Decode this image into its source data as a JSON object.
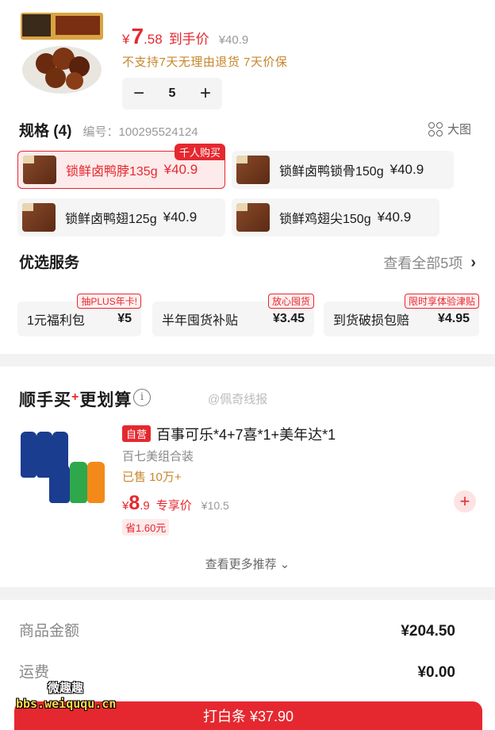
{
  "product": {
    "price_symbol": "¥",
    "price_int": "7",
    "price_dec": ".58",
    "price_label": "到手价",
    "orig_price": "¥40.9",
    "policy": "不支持7天无理由退货  7天价保",
    "stepper": {
      "minus": "−",
      "qty": "5",
      "plus": "+"
    }
  },
  "spec": {
    "title": "规格 (4)",
    "code": "编号：100295524124",
    "big_pic_label": "大图",
    "hot_tag": "千人购买",
    "items": [
      {
        "name": "锁鲜卤鸭脖135g",
        "price": "¥40.9"
      },
      {
        "name": "锁鲜卤鸭锁骨150g",
        "price": "¥40.9"
      },
      {
        "name": "锁鲜卤鸭翅125g",
        "price": "¥40.9"
      },
      {
        "name": "锁鲜鸡翅尖150g",
        "price": "¥40.9"
      }
    ]
  },
  "services": {
    "title": "优选服务",
    "view_all": "查看全部5项",
    "items": [
      {
        "name": "1元福利包",
        "value": "¥5",
        "tag": "抽PLUS年卡!"
      },
      {
        "name": "半年囤货补贴",
        "value": "¥3.45",
        "tag": "放心囤货"
      },
      {
        "name": "到货破损包赔",
        "value": "¥4.95",
        "tag": "限时享体验津贴"
      }
    ]
  },
  "bundle": {
    "title_a": "顺手买",
    "title_plus": "+",
    "title_b": "更划算",
    "info_icon": "i",
    "watermark": "@佩奇线报",
    "self_badge": "自营",
    "name": "百事可乐*4+7喜*1+美年达*1",
    "subtitle": "百七美组合装",
    "sold": "已售 10万+",
    "price_symbol": "¥",
    "price_int": "8",
    "price_dec": ".9",
    "price_label": "专享价",
    "orig_price": "¥10.5",
    "save": "省1.60元",
    "add": "+",
    "more": "查看更多推荐 ⌄"
  },
  "summary": {
    "goods_label": "商品金额",
    "goods_value": "¥204.50",
    "shipping_label": "运费",
    "shipping_value": "¥0.00"
  },
  "pay": {
    "label": "打白条 ¥37.90"
  },
  "overlay": {
    "site": "bbs.weiququ.cn",
    "site_cn": "微趣趣"
  },
  "colors": {
    "accent": "#e5282f",
    "gold": "#c8862c"
  }
}
